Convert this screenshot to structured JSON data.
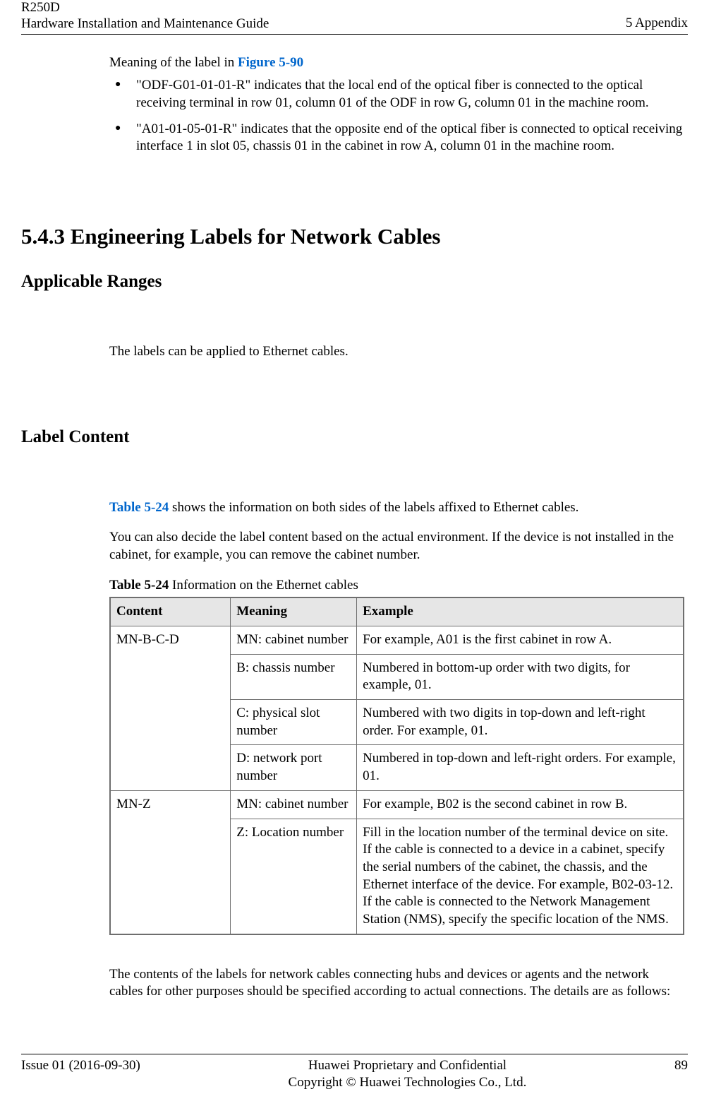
{
  "header": {
    "product": "R250D",
    "guide": "Hardware Installation and Maintenance Guide",
    "chapter": "5 Appendix"
  },
  "intro": {
    "meaning_prefix": "Meaning of the label in ",
    "figure_ref": "Figure 5-90",
    "bullets": [
      "\"ODF-G01-01-01-R\" indicates that the local end of the optical fiber is connected to the optical receiving terminal in row 01, column 01 of the ODF in row G, column 01 in the machine room.",
      "\"A01-01-05-01-R\" indicates that the opposite end of the optical fiber is connected to optical receiving interface 1 in slot 05, chassis 01 in the cabinet in row A, column 01 in the machine room."
    ]
  },
  "section": {
    "number_title": "5.4.3 Engineering Labels for Network Cables",
    "applicable": {
      "heading": "Applicable Ranges",
      "text": "The labels can be applied to Ethernet cables."
    },
    "labelcontent": {
      "heading": "Label Content",
      "para1_pre": "",
      "table_ref": "Table 5-24",
      "para1_post": " shows the information on both sides of the labels affixed to Ethernet cables.",
      "para2": "You can also decide the label content based on the actual environment. If the device is not installed in the cabinet, for example, you can remove the cabinet number.",
      "caption_label": "Table 5-24",
      "caption_desc": " Information on the Ethernet cables",
      "columns": [
        "Content",
        "Meaning",
        "Example"
      ],
      "rows": [
        {
          "content": "MN-B-C-D",
          "span": 4,
          "cells": [
            {
              "meaning": "MN: cabinet number",
              "example": "For example, A01 is the first cabinet in row A."
            },
            {
              "meaning": "B: chassis number",
              "example": "Numbered in bottom-up order with two digits, for example, 01."
            },
            {
              "meaning": "C: physical slot number",
              "example": "Numbered with two digits in top-down and left-right order. For example, 01."
            },
            {
              "meaning": "D: network port number",
              "example": "Numbered in top-down and left-right orders. For example, 01."
            }
          ]
        },
        {
          "content": "MN-Z",
          "span": 2,
          "cells": [
            {
              "meaning": "MN: cabinet number",
              "example": "For example, B02 is the second cabinet in row B."
            },
            {
              "meaning": "Z: Location number",
              "example": "Fill in the location number of the terminal device on site. If the cable is connected to a device in a cabinet, specify the serial numbers of the cabinet, the chassis, and the Ethernet interface of the device. For example, B02-03-12. If the cable is connected to the Network Management Station (NMS), specify the specific location of the NMS."
            }
          ]
        }
      ],
      "after": "The contents of the labels for network cables connecting hubs and devices or agents and the network cables for other purposes should be specified according to actual connections. The details are as follows:"
    }
  },
  "footer": {
    "issue": "Issue 01 (2016-09-30)",
    "line1": "Huawei Proprietary and Confidential",
    "line2": "Copyright © Huawei Technologies Co., Ltd.",
    "page": "89"
  }
}
